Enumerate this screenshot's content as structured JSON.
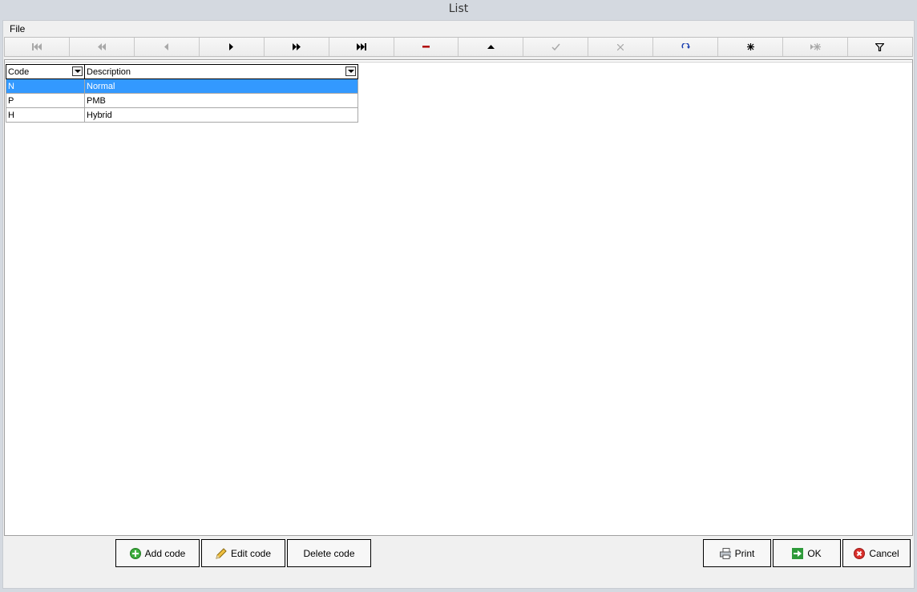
{
  "window": {
    "title": "List"
  },
  "menu": {
    "file_label": "File"
  },
  "nav_icons": [
    "first-record-icon",
    "prior-page-icon",
    "prior-record-icon",
    "next-record-icon",
    "next-page-icon",
    "last-record-icon",
    "delete-record-icon",
    "edit-record-icon",
    "post-icon",
    "cancel-edit-icon",
    "refresh-icon",
    "insert-record-icon",
    "append-record-icon",
    "filter-icon"
  ],
  "grid": {
    "columns": [
      "Code",
      "Description"
    ],
    "rows": [
      {
        "code": "N",
        "description": "Normal",
        "selected": true
      },
      {
        "code": "P",
        "description": "PMB",
        "selected": false
      },
      {
        "code": "H",
        "description": "Hybrid",
        "selected": false
      }
    ]
  },
  "buttons": {
    "add_label": "Add code",
    "edit_label": "Edit code",
    "delete_label": "Delete code",
    "print_label": "Print",
    "ok_label": "OK",
    "cancel_label": "Cancel"
  },
  "colors": {
    "selection": "#3399ff",
    "delete_accent": "#b00000",
    "refresh_accent": "#1a3fb0"
  }
}
